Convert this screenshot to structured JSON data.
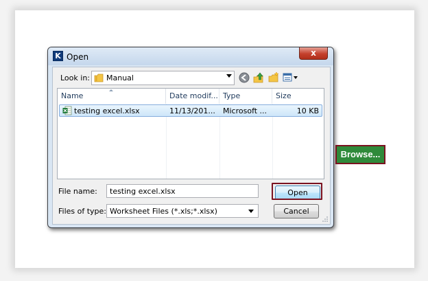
{
  "dialog": {
    "title": "Open",
    "app_icon_letter": "K",
    "close_symbol": "x"
  },
  "lookin": {
    "label": "Look in:",
    "value": "Manual"
  },
  "toolbar": {
    "icons": [
      "back-icon",
      "up-folder-icon",
      "new-folder-icon",
      "views-menu-icon"
    ]
  },
  "file_list": {
    "columns": [
      "Name",
      "Date modif...",
      "Type",
      "Size"
    ],
    "rows": [
      {
        "name": "testing excel.xlsx",
        "date": "11/13/201...",
        "type": "Microsoft ...",
        "size": "10 KB",
        "selected": true
      }
    ]
  },
  "filename": {
    "label": "File name:",
    "value": "testing excel.xlsx"
  },
  "filetype": {
    "label": "Files of type:",
    "value": "Worksheet Files (*.xls;*.xlsx)"
  },
  "buttons": {
    "open": "Open",
    "cancel": "Cancel"
  },
  "browse_button": {
    "label": "Browse..."
  },
  "colors": {
    "highlight": "#7a1220",
    "browse_bg": "#2f8a3a",
    "selection": "#cde6f9"
  }
}
